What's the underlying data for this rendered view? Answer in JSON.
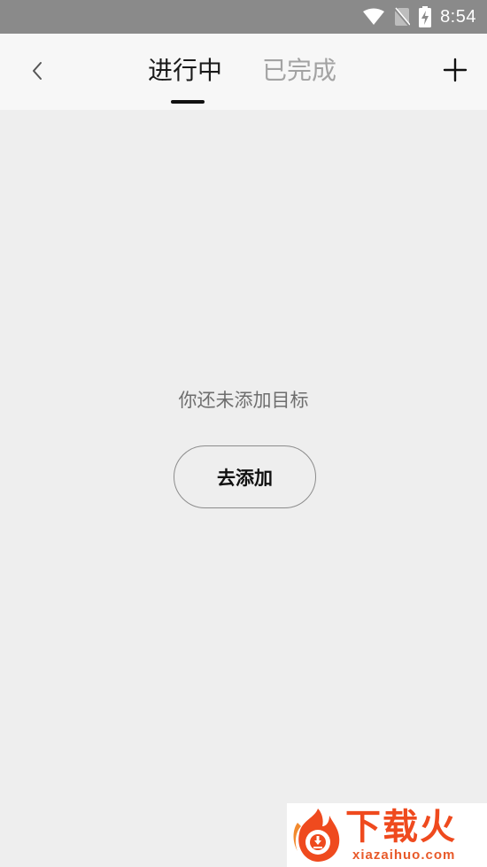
{
  "status_bar": {
    "time": "8:54",
    "icons": [
      "wifi-icon",
      "no-sim-icon",
      "battery-charging-icon"
    ]
  },
  "header": {
    "back_icon": "chevron-left-icon",
    "tabs": [
      {
        "label": "进行中",
        "active": true
      },
      {
        "label": "已完成",
        "active": false
      }
    ],
    "add_icon": "plus-icon"
  },
  "empty_state": {
    "message": "你还未添加目标",
    "button_label": "去添加"
  },
  "watermark": {
    "title": "下载火",
    "url": "xiazaihuo.com"
  },
  "colors": {
    "status_bar": "#8a8a8a",
    "header_bg": "#f7f7f7",
    "page_bg": "#eeeeee",
    "active_tab": "#1a1a1a",
    "inactive_tab": "#a3a3a3",
    "watermark_accent": "#ef4a1e"
  }
}
